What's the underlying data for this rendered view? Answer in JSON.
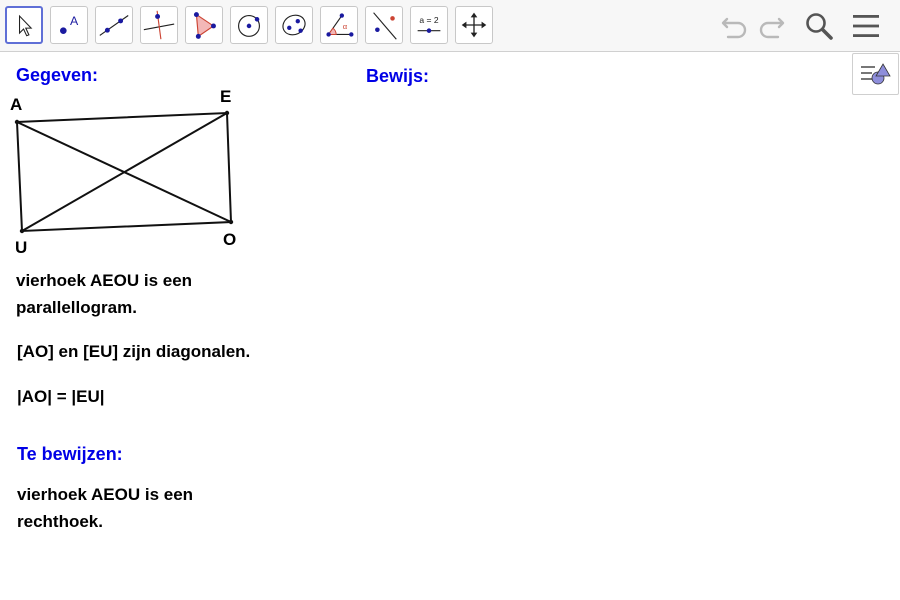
{
  "toolbar": {
    "tools": [
      {
        "name": "move-tool",
        "icon": "cursor-arrow-icon",
        "active": true
      },
      {
        "name": "point-tool",
        "icon": "point-icon",
        "glyph": "A"
      },
      {
        "name": "line-tool",
        "icon": "line-icon"
      },
      {
        "name": "perpendicular-line-tool",
        "icon": "perpendicular-icon"
      },
      {
        "name": "polygon-tool",
        "icon": "polygon-icon"
      },
      {
        "name": "circle-tool",
        "icon": "circle-center-icon"
      },
      {
        "name": "ellipse-tool",
        "icon": "ellipse-icon"
      },
      {
        "name": "angle-tool",
        "icon": "angle-icon",
        "glyph": "α"
      },
      {
        "name": "reflect-tool",
        "icon": "reflect-line-icon"
      },
      {
        "name": "slider-tool",
        "icon": "slider-icon",
        "glyph": "a = 2"
      },
      {
        "name": "move-view-tool",
        "icon": "move-arrows-icon"
      }
    ],
    "undo_icon": "undo-icon",
    "redo_icon": "redo-icon",
    "search_icon": "search-icon",
    "menu_icon": "hamburger-menu-icon"
  },
  "style_bar_icon": "style-bar-toggle-icon",
  "given": {
    "heading": "Gegeven:",
    "statement_1_line_1": "vierhoek AEOU is een",
    "statement_1_line_2": "parallellogram.",
    "statement_2": "[AO] en [EU] zijn diagonalen.",
    "statement_3": "|AO| = |EU|"
  },
  "to_prove": {
    "heading": "Te bewijzen:",
    "line_1": "vierhoek AEOU is een",
    "line_2": "rechthoek."
  },
  "proof": {
    "heading": "Bewijs:"
  },
  "figure": {
    "vertices": [
      {
        "label": "A"
      },
      {
        "label": "E"
      },
      {
        "label": "O"
      },
      {
        "label": "U"
      }
    ]
  },
  "colors": {
    "heading": "#0000e6",
    "active_tool_border": "#5f6fd6",
    "point": "#1a1aa0",
    "polygon_fill": "#f3b7b7"
  }
}
